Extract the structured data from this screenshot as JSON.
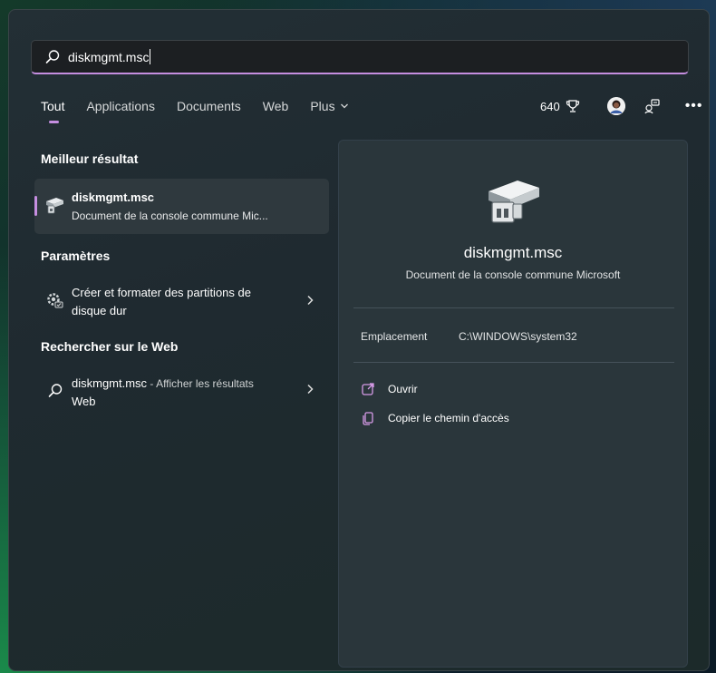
{
  "search": {
    "query": "diskmgmt.msc"
  },
  "tabs": [
    {
      "label": "Tout",
      "active": true
    },
    {
      "label": "Applications"
    },
    {
      "label": "Documents"
    },
    {
      "label": "Web"
    },
    {
      "label": "Plus",
      "icon": "chevron-down-icon"
    }
  ],
  "toolbar": {
    "points": "640",
    "points_icon": "trophy-icon",
    "avatar_icon": "avatar",
    "feedback_icon": "feedback-icon",
    "more_label": "•••"
  },
  "sections": {
    "best": "Meilleur résultat",
    "settings": "Paramètres",
    "web": "Rechercher sur le Web"
  },
  "best_result": {
    "title": "diskmgmt.msc",
    "subtitle": "Document de la console commune Mic..."
  },
  "settings_item": {
    "line1": "Créer et formater des partitions de",
    "line2": "disque dur"
  },
  "web_item": {
    "query": "diskmgmt.msc",
    "suffix": " - Afficher les résultats",
    "line2": "Web"
  },
  "detail": {
    "title": "diskmgmt.msc",
    "subtitle": "Document de la console commune Microsoft",
    "location_label": "Emplacement",
    "location_value": "C:\\WINDOWS\\system32",
    "actions": [
      {
        "label": "Ouvrir",
        "icon": "open-external-icon"
      },
      {
        "label": "Copier le chemin d'accès",
        "icon": "copy-icon"
      }
    ]
  },
  "colors": {
    "accent": "#c58ee0",
    "panel": "#1f2a30",
    "card": "#2f393e",
    "detail": "#2a363b"
  }
}
